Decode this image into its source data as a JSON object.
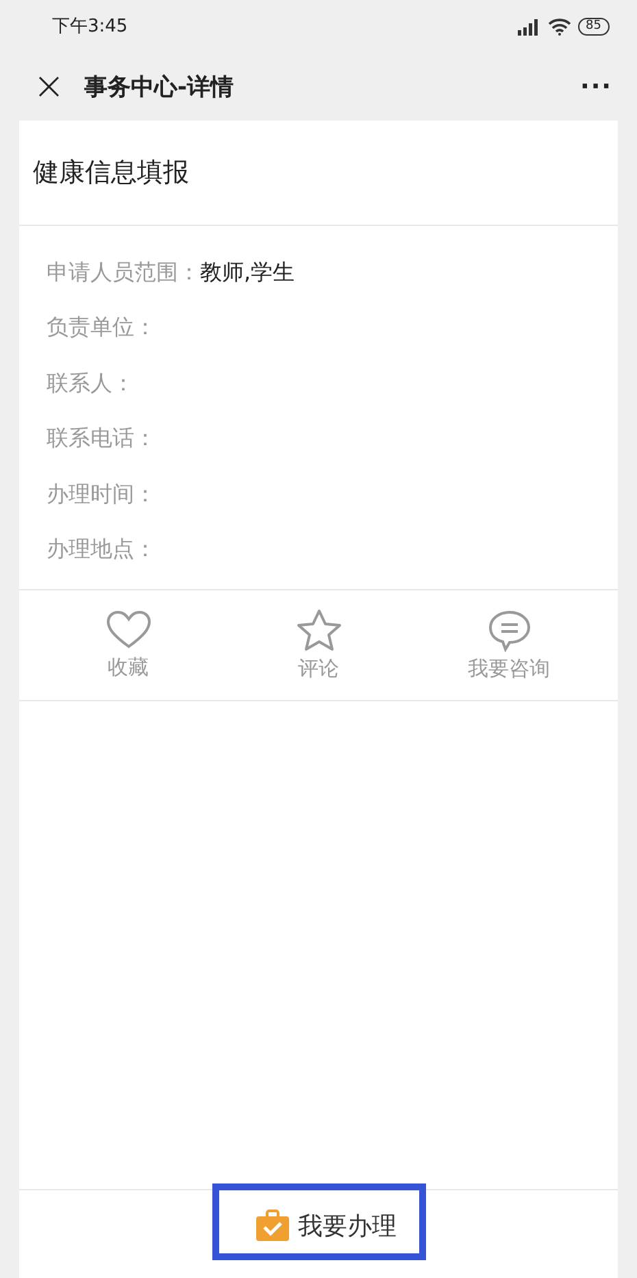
{
  "status_bar": {
    "time": "下午3:45",
    "battery": "85"
  },
  "nav": {
    "close": "×",
    "title": "事务中心-详情",
    "more": "···"
  },
  "item_title": "健康信息填报",
  "fields": [
    {
      "label": "申请人员范围：",
      "value": "教师,学生"
    },
    {
      "label": "负责单位："
    },
    {
      "label": "联系人："
    },
    {
      "label": "联系电话："
    },
    {
      "label": "办理时间："
    },
    {
      "label": "办理地点："
    }
  ],
  "actions": [
    {
      "kind": "favorite",
      "label": "收藏"
    },
    {
      "kind": "comment",
      "label": "评论"
    },
    {
      "kind": "consult",
      "label": "我要咨询"
    }
  ],
  "apply_button": {
    "label": "我要办理",
    "highlighted": true
  }
}
